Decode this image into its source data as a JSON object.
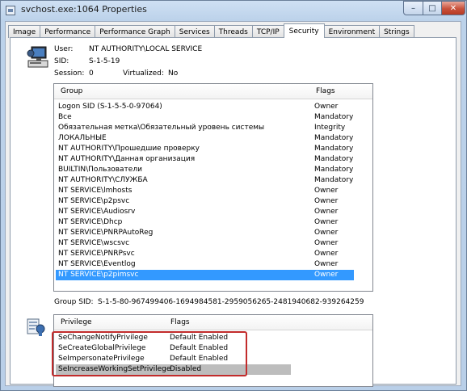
{
  "window": {
    "title": "svchost.exe:1064 Properties"
  },
  "caption_buttons": {
    "minimize": "–",
    "maximize": "□",
    "close": "✕"
  },
  "tabs": [
    {
      "label": "Image"
    },
    {
      "label": "Performance"
    },
    {
      "label": "Performance Graph"
    },
    {
      "label": "Services"
    },
    {
      "label": "Threads"
    },
    {
      "label": "TCP/IP"
    },
    {
      "label": "Security",
      "active": true
    },
    {
      "label": "Environment"
    },
    {
      "label": "Strings"
    }
  ],
  "security": {
    "user_label": "User:",
    "user_value": "NT AUTHORITY\\LOCAL SERVICE",
    "sid_label": "SID:",
    "sid_value": "S-1-5-19",
    "session_label": "Session:",
    "session_value": "0",
    "virtualized_label": "Virtualized:",
    "virtualized_value": "No"
  },
  "groups": {
    "columns": {
      "group": "Group",
      "flags": "Flags"
    },
    "rows": [
      {
        "group": "Logon SID (S-1-5-5-0-97064)",
        "flags": "Owner"
      },
      {
        "group": "Все",
        "flags": "Mandatory"
      },
      {
        "group": "Обязательная метка\\Обязательный уровень системы",
        "flags": "Integrity"
      },
      {
        "group": "ЛОКАЛЬНЫЕ",
        "flags": "Mandatory"
      },
      {
        "group": "NT AUTHORITY\\Прошедшие проверку",
        "flags": "Mandatory"
      },
      {
        "group": "NT AUTHORITY\\Данная организация",
        "flags": "Mandatory"
      },
      {
        "group": "BUILTIN\\Пользователи",
        "flags": "Mandatory"
      },
      {
        "group": "NT AUTHORITY\\СЛУЖБА",
        "flags": "Mandatory"
      },
      {
        "group": "NT SERVICE\\lmhosts",
        "flags": "Owner"
      },
      {
        "group": "NT SERVICE\\p2psvc",
        "flags": "Owner"
      },
      {
        "group": "NT SERVICE\\Audiosrv",
        "flags": "Owner"
      },
      {
        "group": "NT SERVICE\\Dhcp",
        "flags": "Owner"
      },
      {
        "group": "NT SERVICE\\PNRPAutoReg",
        "flags": "Owner"
      },
      {
        "group": "NT SERVICE\\wscsvc",
        "flags": "Owner"
      },
      {
        "group": "NT SERVICE\\PNRPsvc",
        "flags": "Owner"
      },
      {
        "group": "NT SERVICE\\Eventlog",
        "flags": "Owner"
      },
      {
        "group": "NT SERVICE\\p2pimsvc",
        "flags": "Owner",
        "selected": true
      }
    ]
  },
  "group_sid": {
    "label": "Group SID:",
    "value": "S-1-5-80-967499406-1694984581-2959056265-2481940682-939264259"
  },
  "privileges": {
    "columns": {
      "privilege": "Privilege",
      "flags": "Flags"
    },
    "rows": [
      {
        "privilege": "SeChangeNotifyPrivilege",
        "flags": "Default Enabled"
      },
      {
        "privilege": "SeCreateGlobalPrivilege",
        "flags": "Default Enabled"
      },
      {
        "privilege": "SeImpersonatePrivilege",
        "flags": "Default Enabled"
      },
      {
        "privilege": "SeIncreaseWorkingSetPrivilege",
        "flags": "Disabled",
        "highlighted": true
      }
    ]
  },
  "colors": {
    "selection": "#3399ff",
    "annotation_box": "#c22b2b",
    "close_button": "#c8513b"
  }
}
